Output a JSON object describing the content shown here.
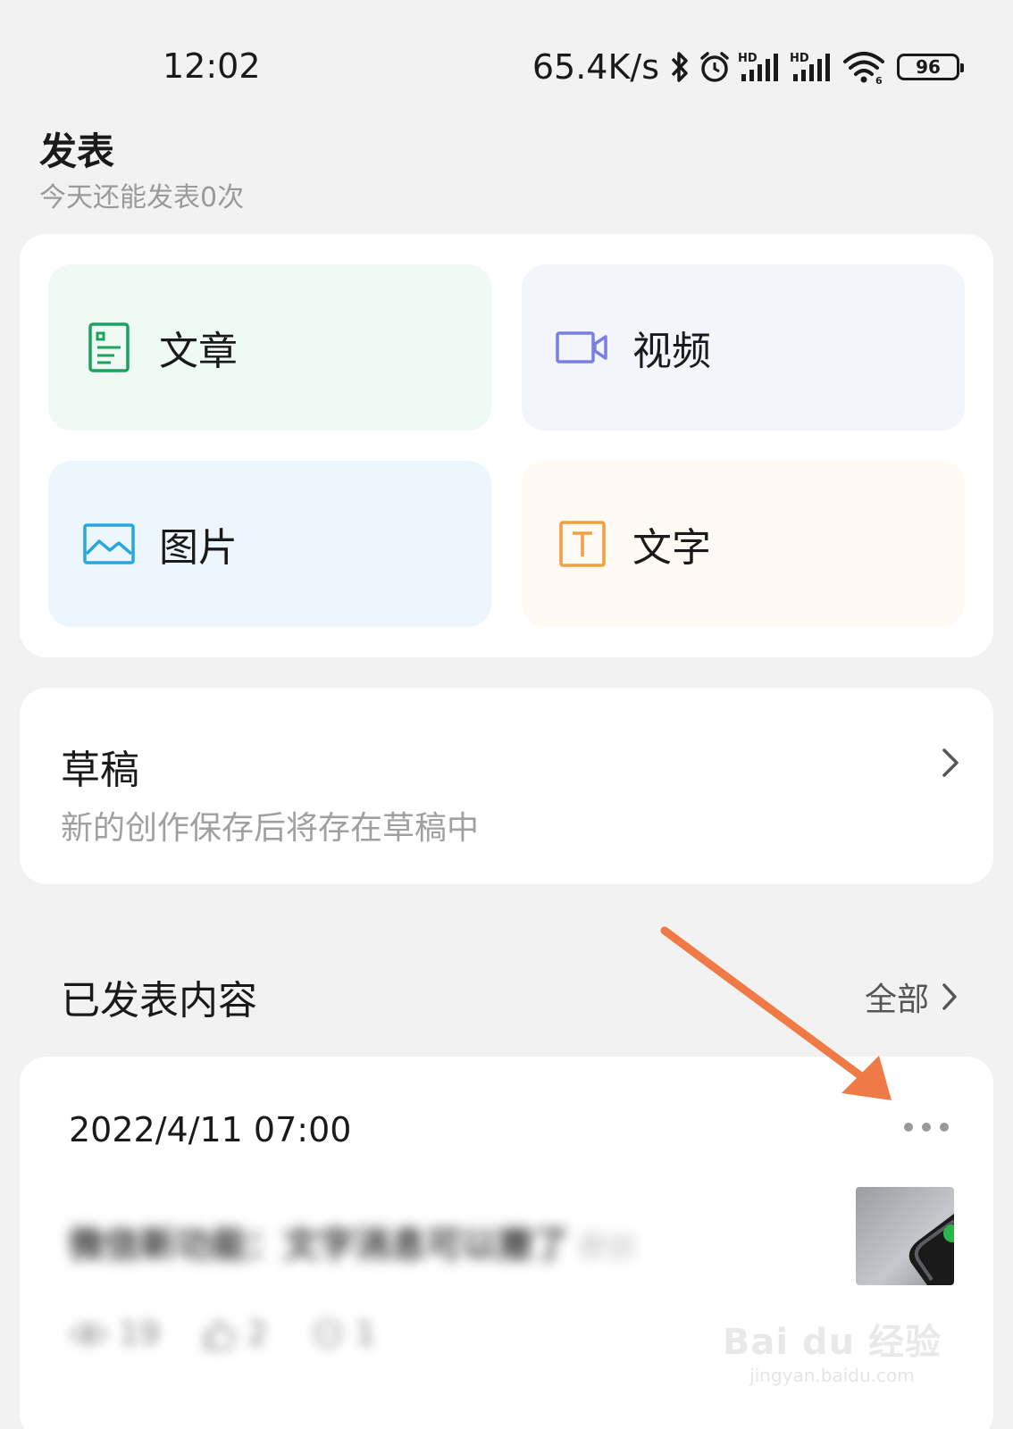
{
  "status_bar": {
    "time": "12:02",
    "net_speed": "65.4K/s",
    "battery": "96",
    "icons": [
      "bluetooth-icon",
      "alarm-icon",
      "hd-signal-icon",
      "hd-signal-icon",
      "wifi-icon",
      "battery-icon"
    ]
  },
  "header": {
    "title": "发表",
    "subtitle": "今天还能发表0次"
  },
  "create": {
    "tiles": [
      {
        "label": "文章",
        "icon": "article-icon",
        "color": "#1aa260"
      },
      {
        "label": "视频",
        "icon": "video-icon",
        "color": "#7b7fe0"
      },
      {
        "label": "图片",
        "icon": "image-icon",
        "color": "#27a6e0"
      },
      {
        "label": "文字",
        "icon": "text-icon",
        "color": "#f0a040"
      }
    ]
  },
  "drafts": {
    "title": "草稿",
    "description": "新的创作保存后将存在草稿中"
  },
  "published": {
    "title": "已发表内容",
    "all_label": "全部",
    "posts": [
      {
        "date": "2022/4/11 07:00",
        "title": "微信新功能：文字消息可以撤了",
        "tag": "原创",
        "views": "19",
        "likes": "2",
        "comments": "1"
      }
    ]
  },
  "watermark": {
    "logo": "Bai du 经验",
    "url": "jingyan.baidu.com"
  },
  "colors": {
    "annotation_arrow": "#f07a45"
  }
}
